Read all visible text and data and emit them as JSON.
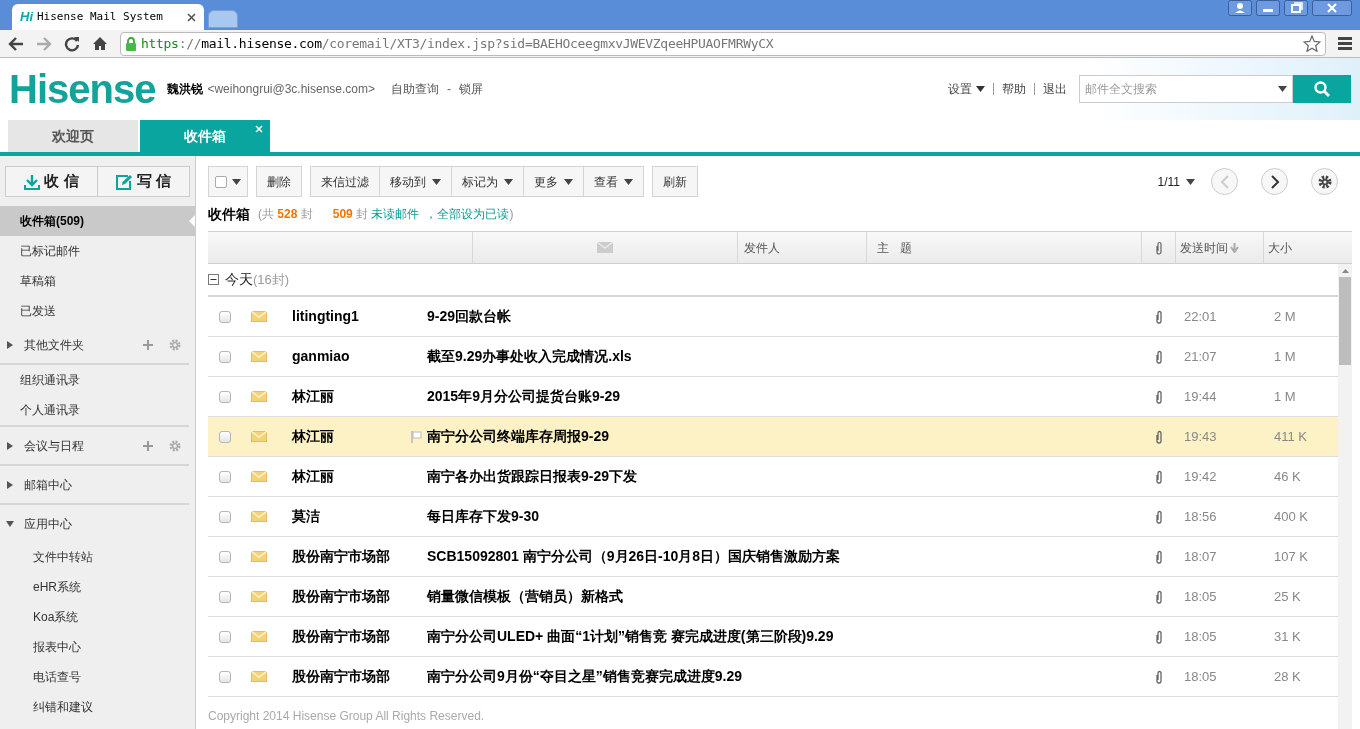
{
  "browser": {
    "favicon_text": "Hi",
    "tab_title": "Hisense Mail System",
    "url_parts": [
      {
        "text": "https",
        "kind": "scheme"
      },
      {
        "text": "://",
        "kind": "plain"
      },
      {
        "text": "mail.hisense.com",
        "kind": "host"
      },
      {
        "text": "/coremail/XT3/index.jsp?sid=BAEHOceegmxvJWEVZqeeHPUAOFMRWyCX",
        "kind": "plain"
      }
    ]
  },
  "header": {
    "logo": "Hisense",
    "user_name": "魏洪锐",
    "email": "<weihongrui@3c.hisense.com>",
    "links": [
      "自助查询",
      "锁屏"
    ],
    "link_separator": "-",
    "right_links": [
      {
        "label": "设置",
        "menu": true
      },
      {
        "label": "帮助",
        "menu": false
      },
      {
        "label": "退出",
        "menu": false
      }
    ],
    "search": {
      "placeholder": "邮件全文搜索"
    }
  },
  "tabs": [
    {
      "label": "欢迎页",
      "selected": false,
      "closable": false
    },
    {
      "label": "收件箱",
      "selected": true,
      "closable": true
    }
  ],
  "sidebar": {
    "buttons": [
      {
        "label": "收 信",
        "kind": "receive"
      },
      {
        "label": "写 信",
        "kind": "compose"
      }
    ],
    "sections": [
      [
        {
          "label": "收件箱(509)",
          "kind": "item",
          "selected": true
        },
        {
          "label": "已标记邮件",
          "kind": "item",
          "selected": false
        },
        {
          "label": "草稿箱",
          "kind": "item",
          "selected": false
        },
        {
          "label": "已发送",
          "kind": "item",
          "selected": false
        },
        {
          "label": "其他文件夹",
          "kind": "group",
          "expanded": false,
          "tools": true
        }
      ],
      [
        {
          "label": "组织通讯录",
          "kind": "item",
          "selected": false
        },
        {
          "label": "个人通讯录",
          "kind": "item",
          "selected": false
        }
      ],
      [
        {
          "label": "会议与日程",
          "kind": "group",
          "expanded": false,
          "tools": true
        }
      ],
      [
        {
          "label": "邮箱中心",
          "kind": "group",
          "expanded": false,
          "tools": false
        }
      ],
      [
        {
          "label": "应用中心",
          "kind": "group",
          "expanded": true,
          "tools": false,
          "children": [
            "文件中转站",
            "eHR系统",
            "Koa系统",
            "报表中心",
            "电话查号",
            "纠错和建议"
          ]
        }
      ]
    ]
  },
  "toolbar": {
    "select_all_checked": false,
    "button_groups": [
      [
        {
          "label": "删除",
          "menu": false
        }
      ],
      [
        {
          "label": "来信过滤",
          "menu": false
        },
        {
          "label": "移动到",
          "menu": true
        },
        {
          "label": "标记为",
          "menu": true
        },
        {
          "label": "更多",
          "menu": true
        },
        {
          "label": "查看",
          "menu": true
        }
      ],
      [
        {
          "label": "刷新",
          "menu": false
        }
      ]
    ],
    "page": "1/11",
    "prev_disabled": true,
    "next_disabled": false
  },
  "summary": {
    "title": "收件箱",
    "open": "(共",
    "total": "528",
    "unit_total": "封",
    "unread": "509",
    "unit_unread": "封",
    "unread_link": "未读邮件",
    "mark_all_link": "，全部设为已读",
    "close": ")"
  },
  "columns": [
    "发件人",
    "主 题",
    "发送时间",
    "大小"
  ],
  "group": {
    "label": "今天",
    "count": "(16封)",
    "expanded": true
  },
  "rows": [
    {
      "sender": "litingting1",
      "subject": "9-29回款台帐",
      "time": "22:01",
      "size": "2 M",
      "selected": false
    },
    {
      "sender": "ganmiao",
      "subject": "截至9.29办事处收入完成情况.xls",
      "time": "21:07",
      "size": "1 M",
      "selected": false
    },
    {
      "sender": "林江丽",
      "subject": "2015年9月分公司提货台账9-29",
      "time": "19:44",
      "size": "1 M",
      "selected": false
    },
    {
      "sender": "林江丽",
      "subject": "南宁分公司终端库存周报9-29",
      "time": "19:43",
      "size": "411 K",
      "selected": true
    },
    {
      "sender": "林江丽",
      "subject": "南宁各办出货跟踪日报表9-29下发",
      "time": "19:42",
      "size": "46 K",
      "selected": false
    },
    {
      "sender": "莫洁",
      "subject": "每日库存下发9-30",
      "time": "18:56",
      "size": "400 K",
      "selected": false
    },
    {
      "sender": "股份南宁市场部",
      "subject": "SCB15092801 南宁分公司（9月26日-10月8日）国庆销售激励方案",
      "time": "18:07",
      "size": "107 K",
      "selected": false
    },
    {
      "sender": "股份南宁市场部",
      "subject": "销量微信模板（营销员）新格式",
      "time": "18:05",
      "size": "25 K",
      "selected": false
    },
    {
      "sender": "股份南宁市场部",
      "subject": "南宁分公司ULED+ 曲面“1计划”销售竞 赛完成进度(第三阶段)9.29",
      "time": "18:05",
      "size": "31 K",
      "selected": false
    },
    {
      "sender": "股份南宁市场部",
      "subject": "南宁分公司9月份“夺目之星”销售竞赛完成进度9.29",
      "time": "18:05",
      "size": "28 K",
      "selected": false
    }
  ],
  "footer": "Copyright 2014 Hisense Group All Rights Reserved."
}
